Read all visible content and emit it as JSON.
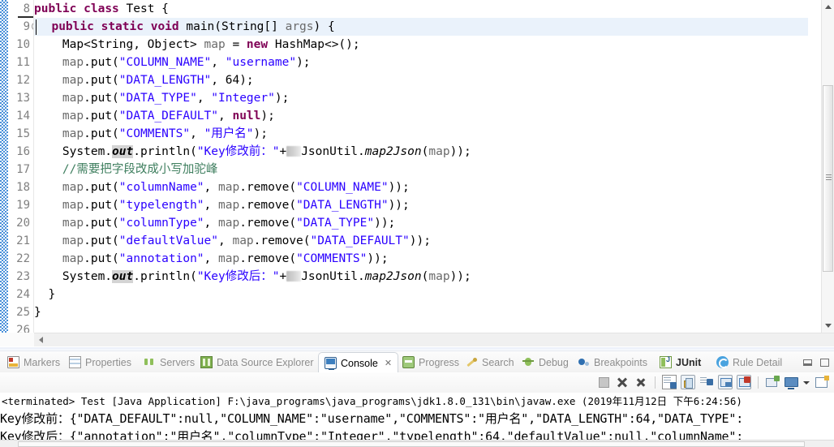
{
  "editor": {
    "lines": [
      {
        "num": "8",
        "indent": 0
      },
      {
        "num": "9",
        "indent": 0,
        "folding": true,
        "highlighted": true
      },
      {
        "num": "10",
        "indent": 0
      },
      {
        "num": "11",
        "indent": 0
      },
      {
        "num": "12",
        "indent": 0
      },
      {
        "num": "13",
        "indent": 0
      },
      {
        "num": "14",
        "indent": 0
      },
      {
        "num": "15",
        "indent": 0
      },
      {
        "num": "16",
        "indent": 0
      },
      {
        "num": "17",
        "indent": 0
      },
      {
        "num": "18",
        "indent": 0
      },
      {
        "num": "19",
        "indent": 0
      },
      {
        "num": "20",
        "indent": 0
      },
      {
        "num": "21",
        "indent": 0
      },
      {
        "num": "22",
        "indent": 0
      },
      {
        "num": "23",
        "indent": 0
      },
      {
        "num": "24",
        "indent": 0
      },
      {
        "num": "25",
        "indent": 0
      },
      {
        "num": "26",
        "indent": 0
      }
    ],
    "code_text": {
      "l8": "public class Test {",
      "l9": "    public static void main(String[] args) {",
      "l10": "        Map<String, Object> map = new HashMap<>();",
      "l11": "        map.put(\"COLUMN_NAME\", \"username\");",
      "l12": "        map.put(\"DATA_LENGTH\", 64);",
      "l13": "        map.put(\"DATA_TYPE\", \"Integer\");",
      "l14": "        map.put(\"DATA_DEFAULT\", null);",
      "l15": "        map.put(\"COMMENTS\", \"用户名\");",
      "l16": "        System.out.println(\"Key修改前：\"+ JsonUtil.map2Json(map));",
      "l17": "        //需要把字段改成小写加驼峰",
      "l18": "        map.put(\"columnName\", map.remove(\"COLUMN_NAME\"));",
      "l19": "        map.put(\"typelength\", map.remove(\"DATA_LENGTH\"));",
      "l20": "        map.put(\"columnType\", map.remove(\"DATA_TYPE\"));",
      "l21": "        map.put(\"defaultValue\", map.remove(\"DATA_DEFAULT\"));",
      "l22": "        map.put(\"annotation\", map.remove(\"COMMENTS\"));",
      "l23": "        System.out.println(\"Key修改后：\"+ JsonUtil.map2Json(map));",
      "l24": "    }",
      "l25": "}"
    },
    "colors": {
      "keyword": "#7f0055",
      "string": "#2a00ff",
      "comment": "#3f7f5f",
      "field": "#0000c0",
      "param": "#6a6a6a",
      "highlight_row": "#eaf2fb",
      "static_highlight": "#d4d4d4",
      "change_ruler": "#4a90d9"
    }
  },
  "view_tabs": [
    {
      "label": "Markers",
      "icon": "markers-icon",
      "active": false
    },
    {
      "label": "Properties",
      "icon": "properties-icon",
      "active": false
    },
    {
      "label": "Servers",
      "icon": "servers-icon",
      "active": false
    },
    {
      "label": "Data Source Explorer",
      "icon": "database-icon",
      "active": false
    },
    {
      "label": "Console",
      "icon": "console-icon",
      "active": true,
      "close": "✕"
    },
    {
      "label": "Progress",
      "icon": "progress-icon",
      "active": false
    },
    {
      "label": "Search",
      "icon": "search-icon",
      "active": false
    },
    {
      "label": "Debug",
      "icon": "debug-icon",
      "active": false
    },
    {
      "label": "Breakpoints",
      "icon": "breakpoints-icon",
      "active": false
    },
    {
      "label": "JUnit",
      "icon": "junit-icon",
      "active": false
    },
    {
      "label": "Rule Detail",
      "icon": "rule-detail-icon",
      "active": false
    }
  ],
  "window_buttons": {
    "minimize": "minimize-icon",
    "maximize": "maximize-icon"
  },
  "console_toolbar": {
    "buttons": [
      "terminate-icon",
      "remove-launch-icon",
      "remove-all-launches-icon",
      "clear-console-icon",
      "scroll-lock-icon",
      "word-wrap-icon",
      "show-console-on-output-icon",
      "pin-console-icon",
      "new-console-view-icon",
      "display-selected-console-icon",
      "console-dropdown-icon",
      "open-console-icon"
    ]
  },
  "console": {
    "status_line": "<terminated> Test [Java Application] F:\\java_programs\\java_programs\\jdk1.8.0_131\\bin\\javaw.exe (2019年11月12日 下午6:24:56)",
    "output_line_1": "Key修改前：{\"DATA_DEFAULT\":null,\"COLUMN_NAME\":\"username\",\"COMMENTS\":\"用户名\",\"DATA_LENGTH\":64,\"DATA_TYPE\":",
    "output_line_2": "Key修改后：{\"annotation\":\"用户名\",\"columnType\":\"Integer\",\"typelength\":64,\"defaultValue\":null,\"columnName\":"
  }
}
